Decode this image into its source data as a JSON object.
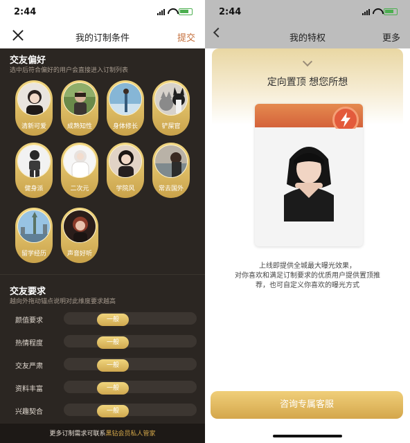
{
  "left": {
    "status": {
      "time": "2:44"
    },
    "nav": {
      "title": "我的订制条件",
      "submit": "提交"
    },
    "preferences": {
      "title": "交友偏好",
      "subtitle": "选中后符合偏好的用户会直接进入订制列表",
      "items": [
        {
          "label": "清新可爱"
        },
        {
          "label": "成熟知性"
        },
        {
          "label": "身体修长"
        },
        {
          "label": "铲屎官"
        },
        {
          "label": "健身派"
        },
        {
          "label": "二次元"
        },
        {
          "label": "学院风"
        },
        {
          "label": "常去国外"
        },
        {
          "label": "留学经历"
        },
        {
          "label": "声音好听"
        }
      ]
    },
    "requirements": {
      "title": "交友要求",
      "subtitle": "越向外拖动锚点说明对此维度要求越高",
      "rows": [
        {
          "label": "颜值要求",
          "value": "一般"
        },
        {
          "label": "热情程度",
          "value": "一般"
        },
        {
          "label": "交友严肃",
          "value": "一般"
        },
        {
          "label": "资料丰富",
          "value": "一般"
        },
        {
          "label": "兴趣契合",
          "value": "一般"
        }
      ]
    },
    "footer": {
      "text": "更多订制需求可联系",
      "highlight": "黑钻会员私人管家"
    }
  },
  "right": {
    "status": {
      "time": "2:44"
    },
    "nav": {
      "title": "我的特权",
      "more": "更多"
    },
    "headline": "定向置顶 想您所想",
    "description": [
      "上线即提供全城最大曝光效果，",
      "对你喜欢和满足订制要求的优质用户提供置顶推",
      "荐，也可自定义你喜欢的曝光方式"
    ],
    "cta": "咨询专属客服"
  }
}
